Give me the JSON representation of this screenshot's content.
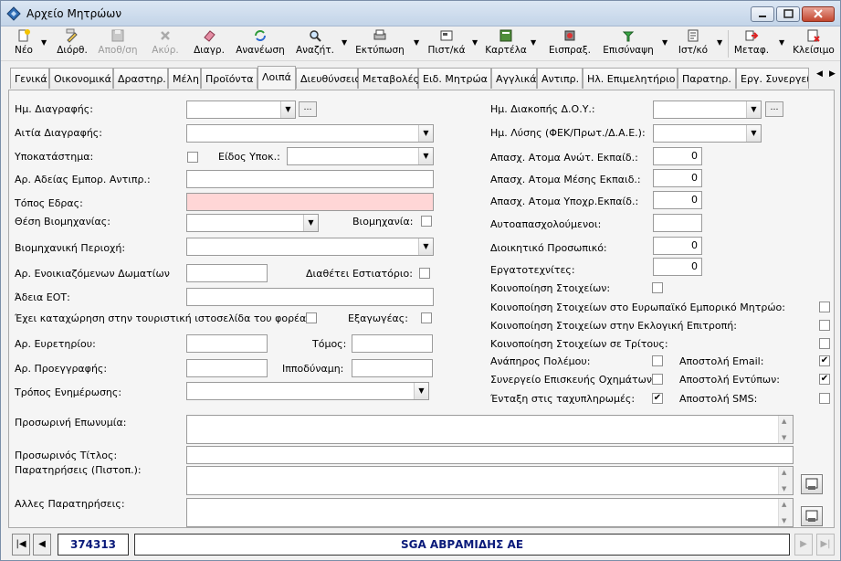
{
  "window": {
    "title": "Αρχείο Μητρώων"
  },
  "toolbar": {
    "items": [
      {
        "label": "Νέο",
        "icon": "new-icon",
        "disabled": false
      },
      {
        "label": "Διόρθ.",
        "icon": "edit-icon",
        "disabled": false
      },
      {
        "label": "Αποθ/ση",
        "icon": "save-icon",
        "disabled": true
      },
      {
        "label": "Ακύρ.",
        "icon": "cancel-icon",
        "disabled": true
      },
      {
        "label": "Διαγρ.",
        "icon": "eraser-icon",
        "disabled": false
      },
      {
        "label": "Ανανέωση",
        "icon": "refresh-icon",
        "disabled": false
      },
      {
        "label": "Αναζήτ.",
        "icon": "search-icon",
        "disabled": false
      },
      {
        "label": "Εκτύπωση",
        "icon": "print-icon",
        "disabled": false
      },
      {
        "label": "Πιστ/κά",
        "icon": "certificate-icon",
        "disabled": false
      },
      {
        "label": "Καρτέλα",
        "icon": "card-icon",
        "disabled": false
      },
      {
        "label": "Εισπραξ.",
        "icon": "collect-icon",
        "disabled": false
      },
      {
        "label": "Επισύναψη",
        "icon": "attach-icon",
        "disabled": false
      },
      {
        "label": "Ιστ/κό",
        "icon": "history-icon",
        "disabled": false
      },
      {
        "label": "Μεταφ.",
        "icon": "transfer-icon",
        "disabled": false
      },
      {
        "label": "Κλείσιμο",
        "icon": "close-doc-icon",
        "disabled": false
      }
    ]
  },
  "tabs": [
    "Γενικά",
    "Οικονομικά",
    "Δραστηρ.",
    "Μέλη",
    "Προϊόντα",
    "Λοιπά",
    "Διευθύνσεις",
    "Μεταβολές",
    "Ειδ. Μητρώα",
    "Αγγλικά",
    "Αντιπρ.",
    "Ηλ. Επιμελητήριο",
    "Παρατηρ.",
    "Εργ. Συνεργεί"
  ],
  "active_tab": "Λοιπά",
  "left": {
    "delete_date": "Ημ. Διαγραφής:",
    "delete_reason": "Αιτία Διαγραφής:",
    "branch": "Υποκατάστημα:",
    "branch_type": "Είδος Υποκ.:",
    "rep_license": "Αρ. Αδείας Εμπορ. Αντιπρ.:",
    "seat": "Τόπος Εδρας:",
    "industry_pos": "Θέση Βιομηχανίας:",
    "industry": "Βιομηχανία:",
    "industry_area": "Βιομηχανική Περιοχή:",
    "rooms": "Αρ. Ενοικιαζόμενων Δωματίων",
    "restaurant": "Διαθέτει Εστιατόριο:",
    "eot": "Άδεια ΕΟΤ:",
    "tourist_site": "Έχει καταχώρηση στην τουριστική ιστοσελίδα του φορέα:",
    "exporter": "Εξαγωγέας:",
    "index_no": "Αρ. Ευρετηρίου:",
    "volume": "Τόμος:",
    "pre_reg": "Αρ. Προεγγραφής:",
    "horsepower": "Ιπποδύναμη:",
    "update_mode": "Τρόπος Ενημέρωσης:"
  },
  "right": {
    "doy_date": "Ημ. Διακοπής Δ.Ο.Υ.:",
    "dissolution": "Ημ. Λύσης (ΦΕΚ/Πρωτ./Δ.Α.Ε.):",
    "emp_high": "Απασχ. Ατομα Ανώτ. Εκπαίδ.:",
    "emp_mid": "Απασχ. Ατομα Μέσης Εκπαιδ.:",
    "emp_basic": "Απασχ. Ατομα Υποχρ.Εκπαίδ.:",
    "self_employed": "Αυτοαπασχολούμενοι:",
    "admin_staff": "Διοικητικό Προσωπικό:",
    "workers": "Εργατοτεχνίτες:",
    "notify": "Κοινοποίηση Στοιχείων:",
    "notify_eu": "Κοινοποίηση Στοιχείων στο Ευρωπαϊκό Εμπορικό Μητρώο:",
    "notify_election": "Κοινοποίηση Στοιχείων στην Εκλογική Επιτροπή:",
    "notify_third": "Κοινοποίηση Στοιχείων σε Τρίτους:",
    "war_disabled": "Ανάπηρος Πολέμου:",
    "send_email": "Αποστολή Email:",
    "car_repair": "Συνεργείο Επισκευής Οχημάτων:",
    "send_print": "Αποστολή Εντύπων:",
    "fast_pay": "Ένταξη στις ταχυπληρωμές:",
    "send_sms": "Αποστολή SMS:",
    "values": {
      "emp_high": "0",
      "emp_mid": "0",
      "emp_basic": "0",
      "admin_staff": "0",
      "workers": "0"
    }
  },
  "checks": {
    "send_email": true,
    "send_print": true,
    "fast_pay": true
  },
  "bottom": {
    "temp_name": "Προσωρινή Επωνυμία:",
    "temp_title": "Προσωρινός Τίτλος:",
    "notes_cert": "Παρατηρήσεις (Πιστοπ.):",
    "other_notes": "Αλλες Παρατηρήσεις:"
  },
  "status": {
    "record_id": "374313",
    "company": "SGA ΑΒΡΑΜΙΔΗΣ ΑΕ"
  },
  "colors": {
    "required": "#ffd6d6",
    "status_text": "#0a1a7a"
  }
}
